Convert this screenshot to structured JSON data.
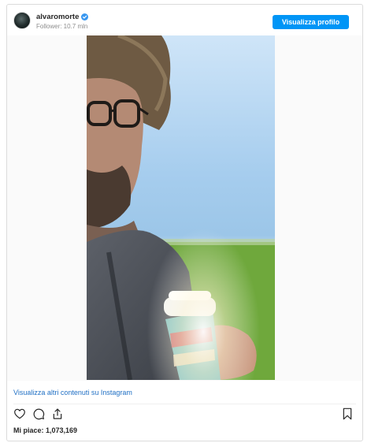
{
  "header": {
    "username": "alvaromorte",
    "followers": "Follower: 10.7 mln",
    "profile_button": "Visualizza profilo"
  },
  "post": {
    "more_link": "Visualizza altri contenuti su Instagram",
    "likes": "Mi piace: 1,073,169"
  },
  "icons": {
    "verified": "verified-badge-icon",
    "like": "heart-icon",
    "comment": "comment-bubble-icon",
    "share": "share-icon",
    "save": "bookmark-icon"
  },
  "colors": {
    "accent": "#0095f6",
    "link": "#1f6fc4",
    "text": "#262626",
    "muted": "#8e8e8e"
  }
}
